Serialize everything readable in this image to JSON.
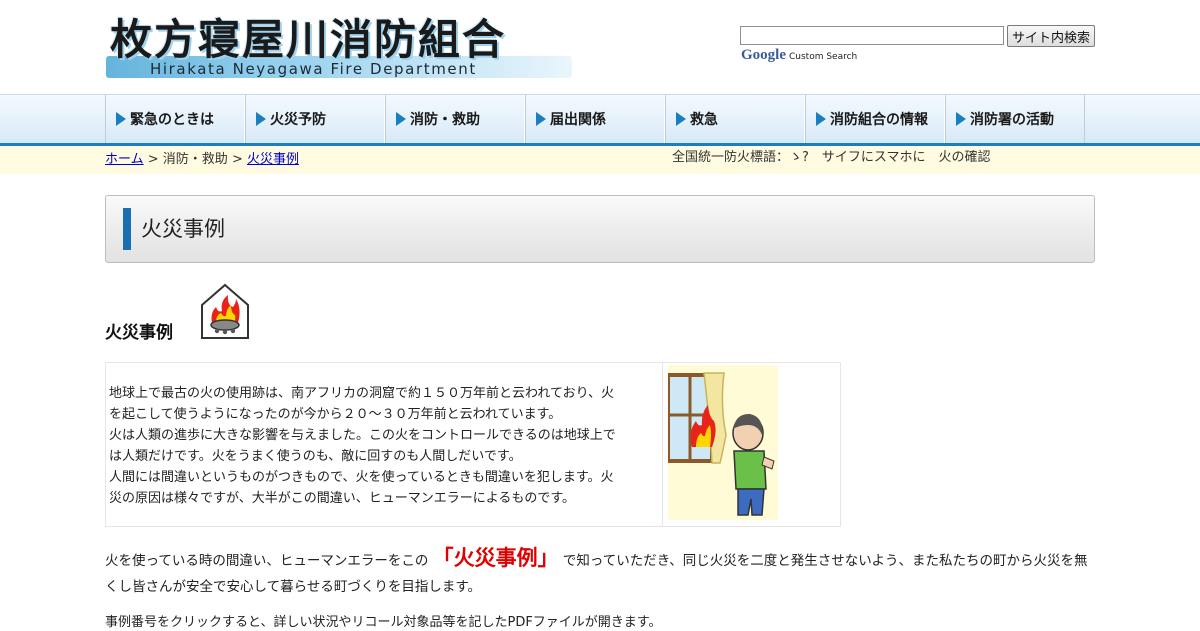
{
  "header": {
    "logo_jp": "枚方寝屋川消防組合",
    "logo_en": "Hirakata Neyagawa Fire Department",
    "search_value": "",
    "search_button": "サイト内検索",
    "google_label": "Google",
    "custom_search_label": "Custom Search"
  },
  "nav": [
    {
      "label": "緊急のときは"
    },
    {
      "label": "火災予防"
    },
    {
      "label": "消防・救助"
    },
    {
      "label": "届出関係"
    },
    {
      "label": "救急"
    },
    {
      "label": "消防組合の情報"
    },
    {
      "label": "消防署の活動"
    }
  ],
  "breadcrumb": {
    "home": "ホーム",
    "sep1": " > ",
    "middle": "消防・救助",
    "sep2": " > ",
    "current": "火災事例"
  },
  "slogan": "全国統一防火標語：ゝ?　サイフにスマホに　火の確認",
  "page_title": "火災事例",
  "section_heading": "火災事例",
  "intro_text": [
    "地球上で最古の火の使用跡は、南アフリカの洞窟で約１５０万年前と云われており、火",
    "を起こして使うようになったのが今から２０～３０万年前と云われています。",
    "火は人類の進歩に大きな影響を与えました。この火をコントロールできるのは地球上で",
    "は人類だけです。火をうまく使うのも、敵に回すのも人間しだいです。",
    "人間には間違いというものがつきもので、火を使っているときも間違いを犯します。火",
    "災の原因は様々ですが、大半がこの間違い、ヒューマンエラーによるものです。"
  ],
  "para1": {
    "before": "火を使っている時の間違い、ヒューマンエラーをこの ",
    "highlight": "「火災事例」",
    "after": " で知っていただき、同じ火災を二度と発生させないよう、また私たちの町から火災を無くし皆さんが安全で安心して暮らせる町づくりを目指します。"
  },
  "para2": "事例番号をクリックすると、詳しい状況やリコール対象品等を記したPDFファイルが開きます。",
  "colors": {
    "accent_blue": "#1b7fbf",
    "highlight_red": "#e00000",
    "crumb_bg": "#fffbe0"
  }
}
